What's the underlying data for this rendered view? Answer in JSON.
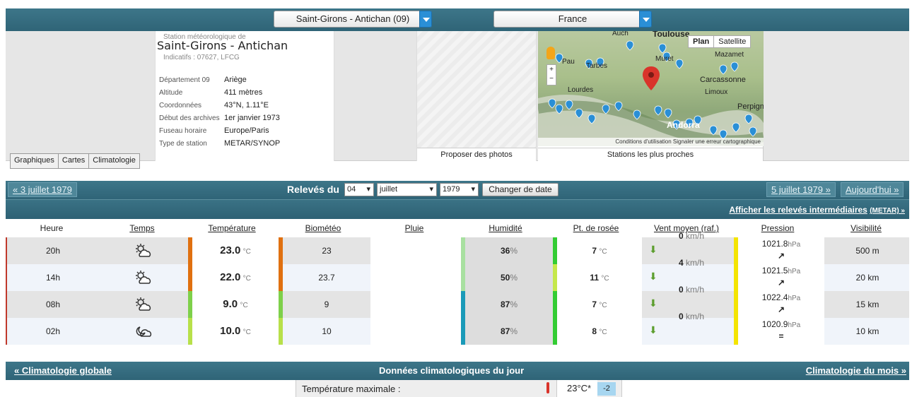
{
  "selectors": {
    "station": "Saint-Girons - Antichan (09)",
    "country": "France"
  },
  "station": {
    "subtitle": "Station météorologique de",
    "name": "Saint-Girons - Antichan",
    "indicatifs": "Indicatifs : 07627, LFCG",
    "details": [
      {
        "k": "Département 09",
        "v": "Ariège"
      },
      {
        "k": "Altitude",
        "v": "411 mètres"
      },
      {
        "k": "Coordonnées",
        "v": "43°N, 1.11°E"
      },
      {
        "k": "Début des archives",
        "v": "1er janvier 1973"
      },
      {
        "k": "Fuseau horaire",
        "v": "Europe/Paris"
      },
      {
        "k": "Type de station",
        "v": "METAR/SYNOP"
      }
    ]
  },
  "tabs": [
    "Graphiques",
    "Cartes",
    "Climatologie"
  ],
  "photo_caption": "Proposer des photos",
  "map": {
    "caption": "Stations les plus proches",
    "plan": "Plan",
    "satellite": "Satellite",
    "places": [
      "Auch",
      "Toulouse",
      "Muret",
      "Mazamet",
      "Pau",
      "Tarbes",
      "Carcassonne",
      "Lourdes",
      "Limoux",
      "Perpignan",
      "Andorra"
    ],
    "footer": "Conditions d'utilisation  Signaler une erreur cartographique"
  },
  "nav": {
    "prev": "« 3 juillet 1979",
    "releves": "Relevés du",
    "day": "04",
    "month": "juillet",
    "year": "1979",
    "change": "Changer de date",
    "next": "5 juillet 1979 »",
    "today": "Aujourd'hui »",
    "intermediate": "Afficher les relevés intermédiaires",
    "metar": "(METAR) »"
  },
  "headers": [
    "Heure",
    "Temps",
    "Température",
    "Biométéo",
    "Pluie",
    "Humidité",
    "Pt. de rosée",
    "Vent moyen (raf.)",
    "Pression",
    "Visibilité"
  ],
  "rows": [
    {
      "h": "20h",
      "icon": "sun-cloud-icon",
      "temp": "23.0",
      "bio": "23",
      "pluie": "",
      "hum": "36",
      "dew": "7",
      "wind": "0",
      "press": "1021.8",
      "trend": "↗",
      "vis": "500 m",
      "tcolor": "#e07010",
      "hcolor": "#a8e0a0",
      "dcolor": "#33cc33",
      "pcolor": "#f4e400"
    },
    {
      "h": "14h",
      "icon": "sun-cloud-icon",
      "temp": "22.0",
      "bio": "23.7",
      "pluie": "",
      "hum": "50",
      "dew": "11",
      "wind": "4",
      "press": "1021.5",
      "trend": "↗",
      "vis": "20 km",
      "tcolor": "#e07010",
      "hcolor": "#a8e0a0",
      "dcolor": "#c5e84a",
      "pcolor": "#f4e400"
    },
    {
      "h": "08h",
      "icon": "sun-cloud-icon",
      "temp": "9.0",
      "bio": "9",
      "pluie": "",
      "hum": "87",
      "dew": "7",
      "wind": "0",
      "press": "1022.4",
      "trend": "↗",
      "vis": "15 km",
      "tcolor": "#7ed04a",
      "hcolor": "#1a9ab8",
      "dcolor": "#33cc33",
      "pcolor": "#f4e400"
    },
    {
      "h": "02h",
      "icon": "moon-cloud-icon",
      "temp": "10.0",
      "bio": "10",
      "pluie": "",
      "hum": "87",
      "dew": "8",
      "wind": "0",
      "press": "1020.9",
      "trend": "=",
      "vis": "10 km",
      "tcolor": "#b8e04a",
      "hcolor": "#1a9ab8",
      "dcolor": "#33cc33",
      "pcolor": "#f4e400"
    }
  ],
  "units": {
    "temp": "°C",
    "pct": "%",
    "wind": "km/h",
    "press": "hPa"
  },
  "climato": {
    "left": "« Climatologie globale",
    "center": "Données climatologiques du jour",
    "right": "Climatologie du mois »",
    "tmax_label": "Température maximale :",
    "tmax_value": "23°C*",
    "tmax_delta": "-2"
  },
  "colors": {
    "header_bar": "#336b7e",
    "row_alt": "#f0f4fa",
    "row_gray": "#e4e4e4"
  }
}
